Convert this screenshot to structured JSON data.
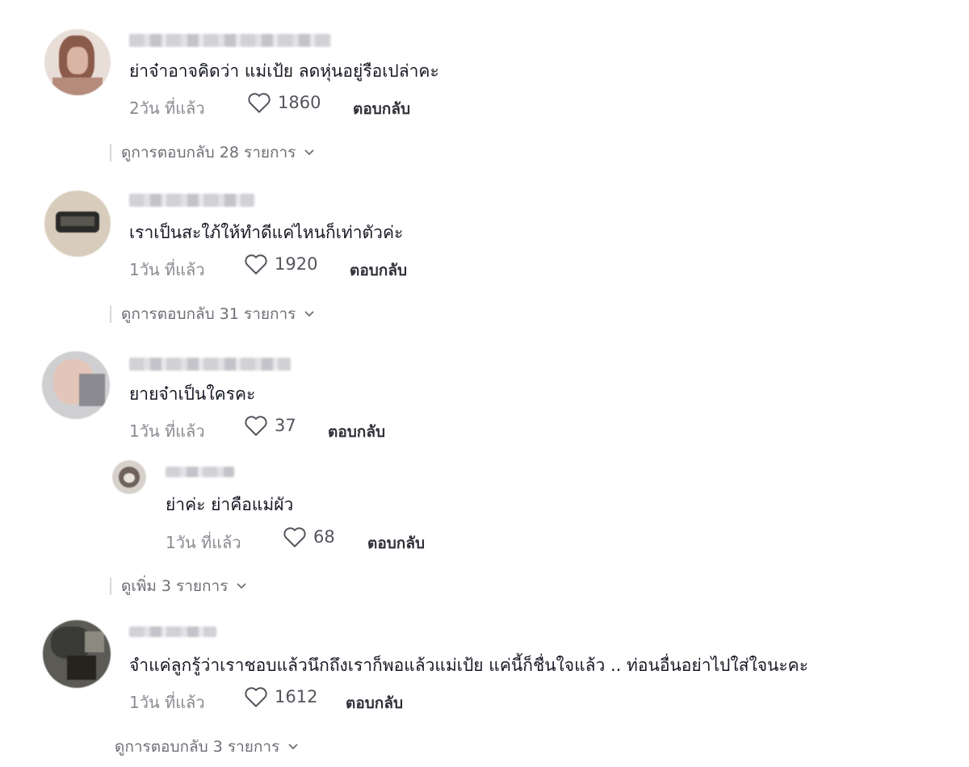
{
  "comments": [
    {
      "text": "ย่าจ๋าอาจคิดว่า แม่เป้ย ลดหุ่นอยู่รือเปล่าคะ",
      "time": "2วัน ที่แล้ว",
      "likes": "1860",
      "reply_label": "ตอบกลับ",
      "view_replies": "ดูการตอบกลับ 28 รายการ"
    },
    {
      "text": "เราเป็นสะใภ้ให้ทำดีแค่ไหนก็เท่าตัวค่ะ",
      "time": "1วัน ที่แล้ว",
      "likes": "1920",
      "reply_label": "ตอบกลับ",
      "view_replies": "ดูการตอบกลับ 31 รายการ"
    },
    {
      "text": "ยายจ๋าเป็นใครคะ",
      "time": "1วัน ที่แล้ว",
      "likes": "37",
      "reply_label": "ตอบกลับ",
      "reply": {
        "text": "ย่าค่ะ ย่าคือแม่ผัว",
        "time": "1วัน ที่แล้ว",
        "likes": "68",
        "reply_label": "ตอบกลับ"
      },
      "view_replies": "ดูเพิ่ม 3 รายการ"
    },
    {
      "text": "จำแค่ลูกรู้ว่าเราชอบแล้วนึกถึงเราก็พอแล้วแม่เป้ย แค่นี้ก็ชื่นใจแล้ว .. ท่อนอื่นอย่าไปใส่ใจนะคะ",
      "time": "1วัน ที่แล้ว",
      "likes": "1612",
      "reply_label": "ตอบกลับ",
      "view_replies": "ดูการตอบกลับ 3 รายการ"
    }
  ],
  "icons": {
    "like": "heart-outline-icon",
    "expand": "chevron-down-icon"
  },
  "colors": {
    "text": "#161823",
    "meta": "#8a8b91",
    "reply": "#2f3038"
  }
}
